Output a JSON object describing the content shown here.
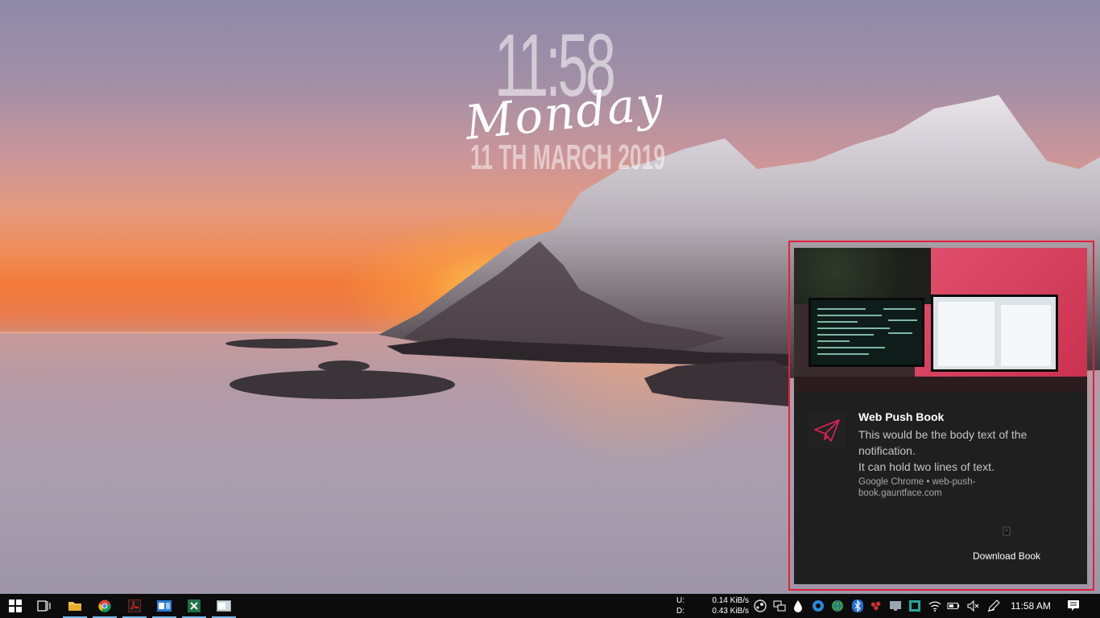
{
  "wallpaper": {
    "clock_time": "11:58",
    "clock_day": "Monday",
    "clock_date": "11 TH MARCH 2019"
  },
  "notification": {
    "title": "Web Push Book",
    "body_line_1": "This would be the body text of the notification.",
    "body_line_2": "It can hold two lines of text.",
    "source": "Google Chrome • web-push-book.gauntface.com",
    "action_label": "Download Book",
    "app_icon": "paper-plane-icon",
    "action_icon": "book-icon",
    "accent_color": "#e2203a"
  },
  "taskbar": {
    "apps": [
      {
        "name": "start-button",
        "icon": "windows-icon"
      },
      {
        "name": "task-view-button",
        "icon": "task-view-icon"
      },
      {
        "name": "file-explorer-button",
        "icon": "folder-icon"
      },
      {
        "name": "chrome-button",
        "icon": "chrome-icon"
      },
      {
        "name": "acrobat-button",
        "icon": "pdf-icon"
      },
      {
        "name": "outlook-button",
        "icon": "mail-icon"
      },
      {
        "name": "excel-button",
        "icon": "excel-icon"
      },
      {
        "name": "window-button",
        "icon": "window-icon"
      }
    ],
    "network": {
      "upload_label": "U:",
      "download_label": "D:",
      "upload_value": "0.14 KiB/s",
      "download_value": "0.43 KiB/s"
    },
    "clock": "11:58 AM"
  }
}
